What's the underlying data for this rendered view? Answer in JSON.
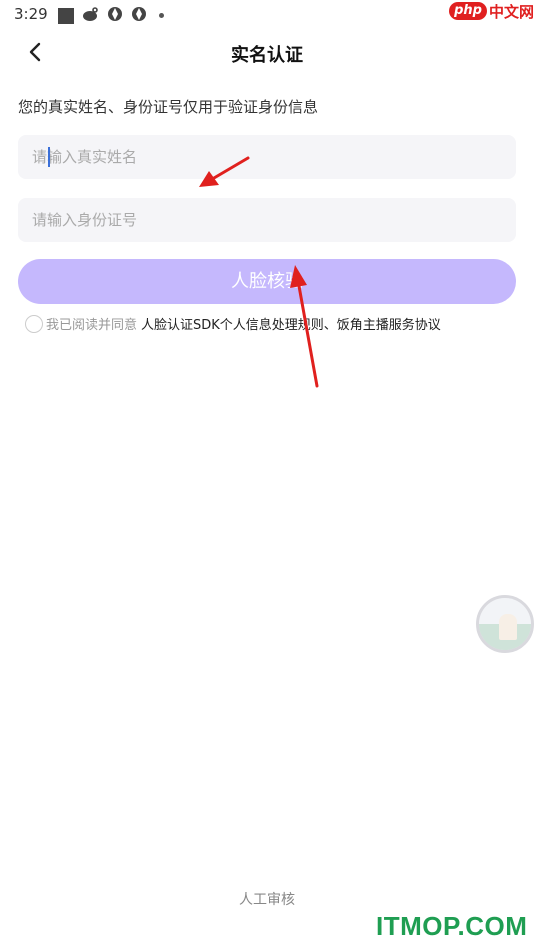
{
  "status_bar": {
    "time": "3:29",
    "icons": [
      "square-icon",
      "weibo-icon",
      "app-icon",
      "app-icon",
      "dot-icon"
    ]
  },
  "watermark_top": {
    "brand": "php",
    "text": "中文网"
  },
  "header": {
    "title": "实名认证",
    "back_icon": "chevron-left-icon"
  },
  "hint": "您的真实姓名、身份证号仅用于验证身份信息",
  "form": {
    "name_placeholder": "请输入真实姓名",
    "id_placeholder": "请输入身份证号",
    "submit_label": "人脸核验",
    "submit_color": "#c5b8fd"
  },
  "agreement": {
    "prefix": "我已阅读并同意",
    "links": "人脸认证SDK个人信息处理规则、饭角主播服务协议"
  },
  "footer": {
    "manual_review": "人工审核",
    "watermark": "ITMOP.COM"
  },
  "annotation_color": "#e0201e"
}
